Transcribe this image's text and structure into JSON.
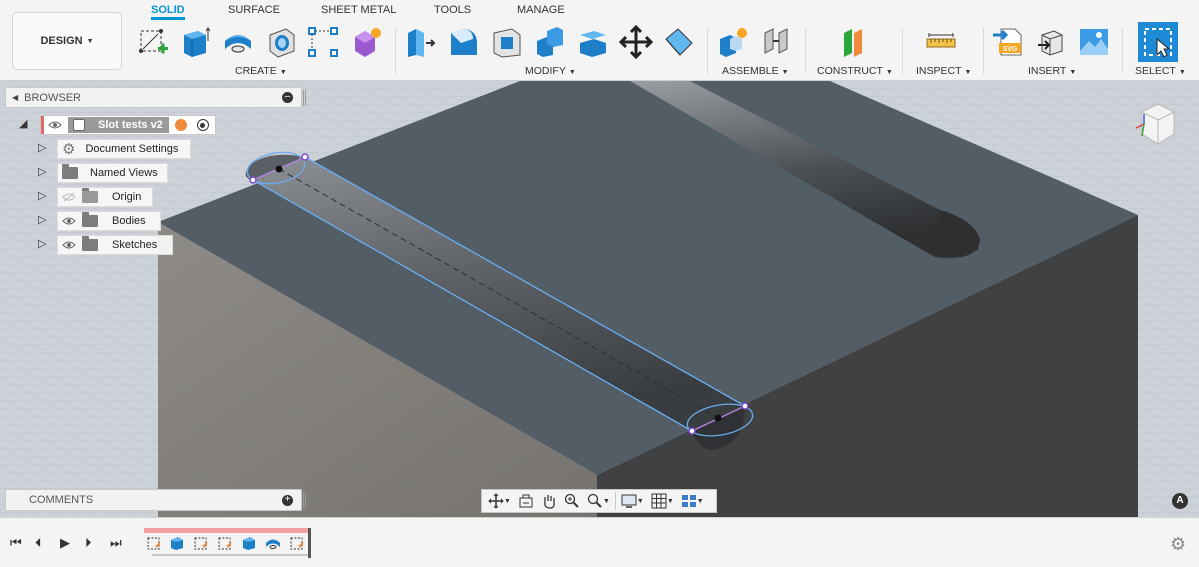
{
  "workspace": {
    "label": "DESIGN"
  },
  "tabs": [
    {
      "label": "SOLID",
      "active": true
    },
    {
      "label": "SURFACE"
    },
    {
      "label": "SHEET METAL"
    },
    {
      "label": "TOOLS"
    },
    {
      "label": "MANAGE"
    }
  ],
  "groups": {
    "create": "CREATE",
    "modify": "MODIFY",
    "assemble": "ASSEMBLE",
    "construct": "CONSTRUCT",
    "inspect": "INSPECT",
    "insert": "INSERT",
    "select": "SELECT"
  },
  "browser": {
    "title": "BROWSER",
    "root": "Slot tests v2",
    "items": [
      {
        "label": "Document Settings",
        "icon": "gear-icon"
      },
      {
        "label": "Named Views",
        "icon": "folder-icon"
      },
      {
        "label": "Origin",
        "icon": "folder-icon",
        "hidden": true
      },
      {
        "label": "Bodies",
        "icon": "folder-icon"
      },
      {
        "label": "Sketches",
        "icon": "folder-icon"
      }
    ]
  },
  "comments": {
    "title": "COMMENTS"
  },
  "insert_svg_label": "SVG",
  "badge": "A",
  "colors": {
    "accent": "#0696d7",
    "top_face": "#535d66",
    "left_face": "#858380",
    "right_face": "#3f4142",
    "grid": "#ccd2d8",
    "timeline_bar": "#f2a0a0"
  }
}
